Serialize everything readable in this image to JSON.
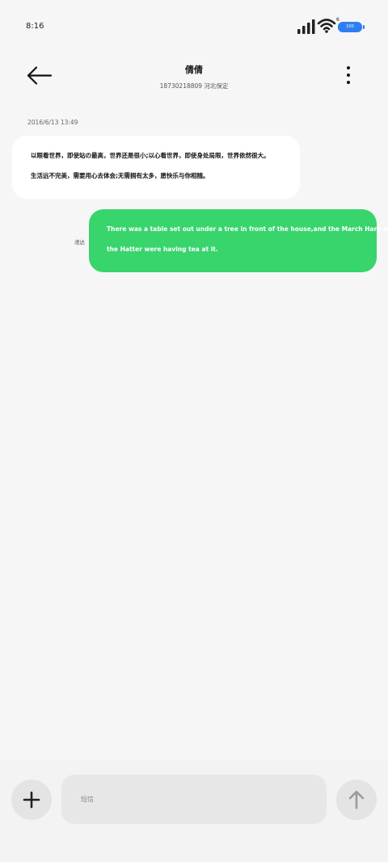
{
  "status_bar": {
    "time": "8:16",
    "battery_level": "100",
    "wifi_tag": "6",
    "icons": [
      "signal-icon",
      "wifi-icon",
      "battery-icon"
    ],
    "battery_color": "#2f7ff0"
  },
  "header": {
    "contact_name": "倩倩",
    "contact_detail": "18730218809 河北保定",
    "back_icon": "arrow-left-icon",
    "more_icon": "more-vertical-icon"
  },
  "conversation": {
    "timestamp": "2016/6/13 13:49",
    "incoming": {
      "lines": [
        "以眼看世界，即使站の最高，世界还是很小;以心看世界，即使身处局限，世界依然很大。",
        "生活远不完美，需要用心去体会;无需拥有太多，愿快乐与你相随。"
      ],
      "bubble_color": "#ffffff"
    },
    "outgoing": {
      "status": "递达",
      "lines": [
        "There was a table set out under a tree in front of the house,and the March Hare and",
        "the Hatter were having tea at it."
      ],
      "bubble_color": "#38d46c"
    }
  },
  "composer": {
    "placeholder": "短信",
    "value": "",
    "plus_icon": "plus-icon",
    "send_icon": "arrow-up-icon"
  }
}
